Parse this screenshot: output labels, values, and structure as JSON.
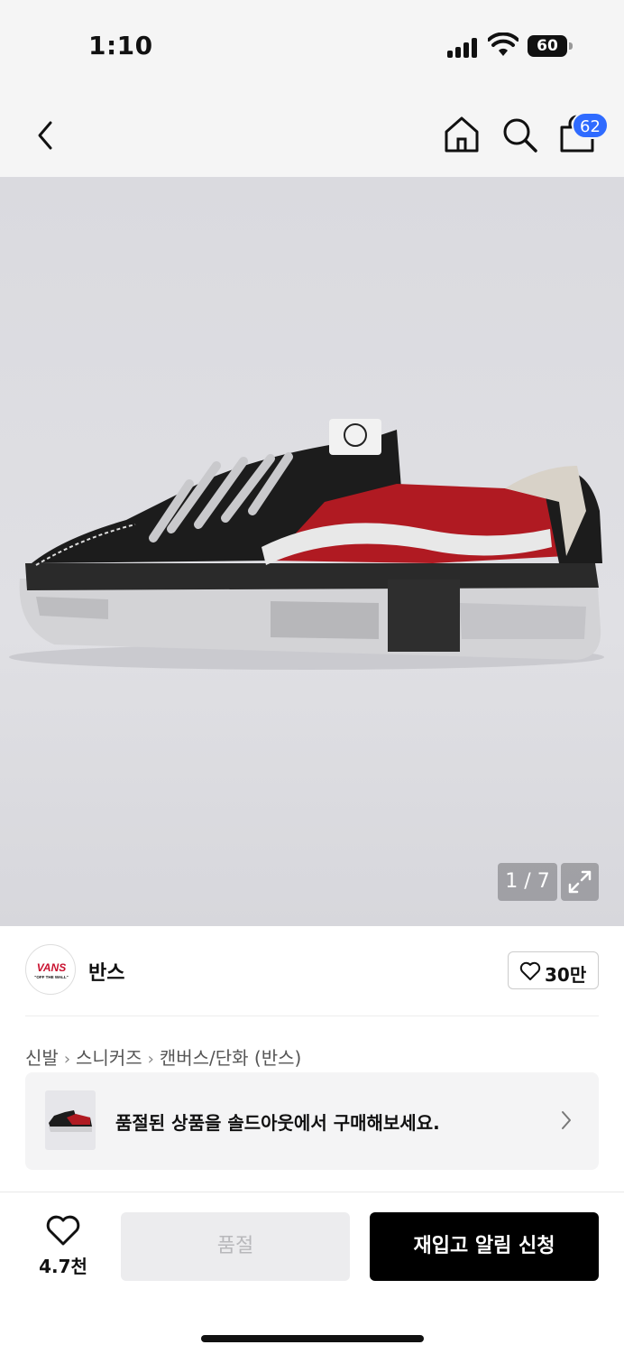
{
  "status_bar": {
    "time": "1:10",
    "battery": "60"
  },
  "nav": {
    "cart_count": "62"
  },
  "gallery": {
    "page_indicator": "1 / 7"
  },
  "brand": {
    "name": "반스",
    "logo_text": "VANS",
    "logo_subtext": "\"OFF THE WALL\"",
    "likes": "30만"
  },
  "breadcrumb": [
    "신발",
    "스니커즈",
    "캔버스/단화 (반스)"
  ],
  "soldout_banner": {
    "text": "품절된 상품을 솔드아웃에서 구매해보세요."
  },
  "bottom": {
    "wish_count": "4.7천",
    "soldout_label": "품절",
    "restock_label": "재입고 알림 신청"
  },
  "colors": {
    "accent": "#2f6bff",
    "primary_button": "#000000",
    "disabled_button": "#ececee"
  }
}
